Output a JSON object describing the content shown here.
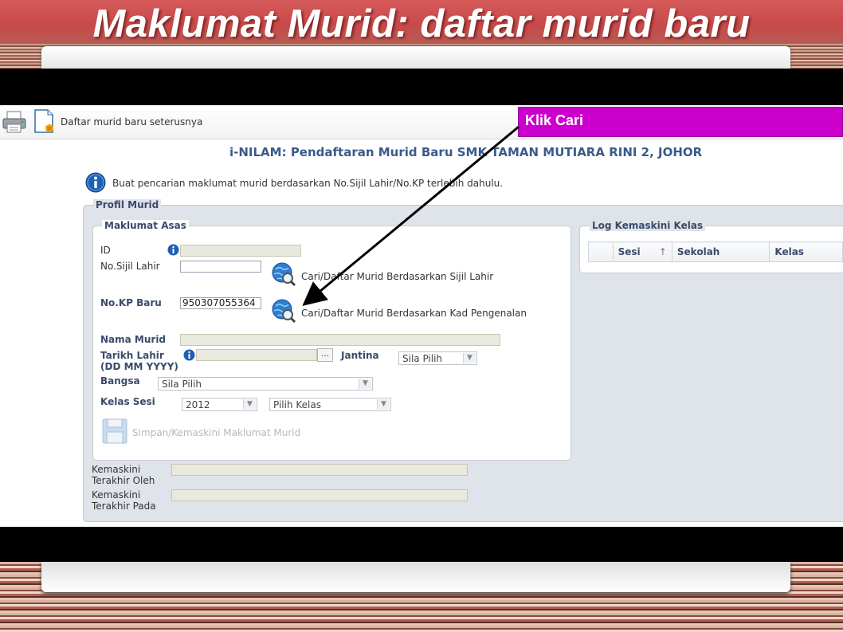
{
  "slide": {
    "title": "Maklumat Murid: daftar murid baru"
  },
  "toolbar": {
    "new_student_label": "Daftar murid baru seterusnya"
  },
  "callout": {
    "label": "Klik Cari"
  },
  "page": {
    "title": "i-NILAM: Pendaftaran Murid Baru SMK TAMAN MUTIARA RINI 2, JOHOR",
    "info_text": "Buat pencarian maklumat murid berdasarkan No.Sijil Lahir/No.KP terlebih dahulu."
  },
  "profil": {
    "legend": "Profil Murid",
    "asas": {
      "legend": "Maklumat Asas",
      "id_label": "ID",
      "id_value": "",
      "sijil_label": "No.Sijil Lahir",
      "sijil_value": "",
      "search_sijil_label": "Cari/Daftar Murid Berdasarkan Sijil Lahir",
      "kp_label": "No.KP Baru",
      "kp_value": "950307055364",
      "search_kp_label": "Cari/Daftar Murid Berdasarkan Kad Pengenalan",
      "nama_label": "Nama Murid",
      "nama_value": "",
      "tarikh_label_1": "Tarikh Lahir",
      "tarikh_label_2": "(DD MM YYYY)",
      "tarikh_value": "",
      "date_picker_label": "...",
      "jantina_label": "Jantina",
      "jantina_selected": "Sila Pilih",
      "bangsa_label": "Bangsa",
      "bangsa_selected": "Sila Pilih",
      "kelas_sesi_label": "Kelas Sesi",
      "sesi_selected": "2012",
      "kelas_selected": "Pilih Kelas",
      "save_label": "Simpan/Kemaskini Maklumat Murid"
    },
    "kemaskini_oleh_label_1": "Kemaskini",
    "kemaskini_oleh_label_2": "Terakhir Oleh",
    "kemaskini_oleh_value": "",
    "kemaskini_pada_label_1": "Kemaskini",
    "kemaskini_pada_label_2": "Terakhir Pada",
    "kemaskini_pada_value": ""
  },
  "log": {
    "legend": "Log Kemaskini Kelas",
    "columns": [
      "",
      "Sesi",
      "Sekolah",
      "Kelas"
    ],
    "sort_indicator": "↑"
  },
  "colors": {
    "callout": "#cc00cc",
    "title_text": "#3a5a8a",
    "panel_bg": "#dfe3ea"
  }
}
